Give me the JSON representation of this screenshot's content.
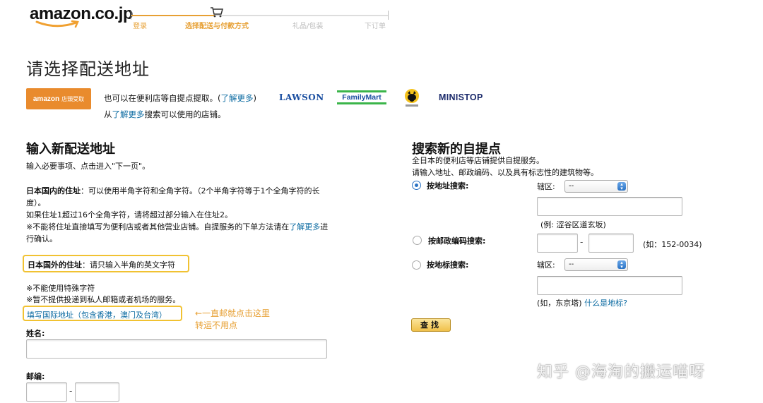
{
  "header": {
    "logo_text": "amazon.co.jp",
    "steps": [
      "登录",
      "选择配送与付款方式",
      "礼品/包装",
      "下订单"
    ]
  },
  "page_title": "请选择配送地址",
  "pickup": {
    "logo_main": "amazon",
    "logo_sub": "店頭受取",
    "line1_text": "也可以在便利店等自提点提取。(",
    "line1_link": "了解更多",
    "line1_end": ")",
    "line2_pre": "从",
    "line2_link": "了解更多",
    "line2_post": "搜索可以使用的店铺。",
    "stores": {
      "lawson": "LAWSON",
      "familymart": "FamilyMart",
      "ministop": "MINISTOP"
    }
  },
  "left": {
    "heading": "输入新配送地址",
    "intro": "输入必要事项、点击进入\"下一页\"。",
    "domestic_label": "日本国内的住址",
    "domestic_text": "：可以使用半角字符和全角字符。（2个半角字符等于1个全角字符的长度）。",
    "domestic_note1": "如果住址1超过16个全角字符，请将超过部分输入在住址2。",
    "domestic_note2": "※不能将住址直接填写为便利店或者其他营业店铺。自提服务的下单方法请在",
    "domestic_note2_link": "了解更多",
    "domestic_note2_end": "进行确认。",
    "foreign_label": "日本国外的住址",
    "foreign_text": "：请只输入半角的英文字符",
    "note_special": "※不能使用特殊字符",
    "note_po": "※暂不提供投递到私人邮箱或者机场的服务。",
    "intl_link": "填写国际地址（包含香港，澳门及台湾）",
    "annotation_line1": "←一直邮就点击这里",
    "annotation_line2": "转运不用点",
    "name_label": "姓名:",
    "postcode_label": "邮编:",
    "dash": "-"
  },
  "right": {
    "heading": "搜索新的自提点",
    "intro_line1": "全日本的便利店等店铺提供自提服务。",
    "intro_line2": "请输入地址、邮政编码、以及具有标志性的建筑物等。",
    "opt_address": "按地址搜索:",
    "opt_postcode": "按邮政编码搜索:",
    "opt_landmark": "按地标搜索:",
    "district_label": "辖区:",
    "select_value": "--",
    "address_example": "(例:  涩谷区道玄坂)",
    "postcode_example": "(如：152-0034)",
    "landmark_example": "(如，东京塔)",
    "landmark_link": "什么是地标?",
    "dash": "-",
    "search_button": "查找"
  },
  "watermark": "知乎 @海淘的搬运喵呀",
  "colors": {
    "accent": "#e7a034",
    "link": "#0a6aa1",
    "highlight_box": "#f1c232",
    "radio_selected": "#2b73c4"
  }
}
